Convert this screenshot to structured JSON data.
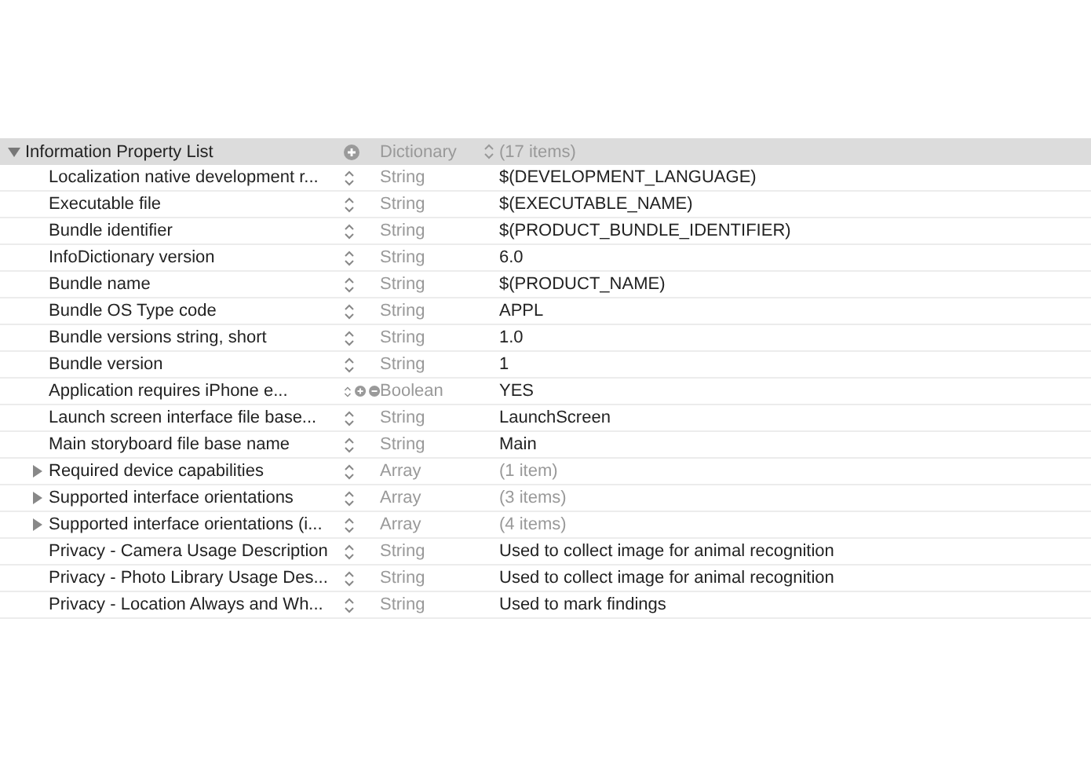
{
  "property_list": {
    "key": "Information Property List",
    "kind": "dictionary",
    "type": "Dictionary",
    "value": "(17 items)",
    "expanded": true,
    "children": [
      {
        "key": "Localization native development r...",
        "kind": "string",
        "type": "String",
        "value": "$(DEVELOPMENT_LANGUAGE)",
        "hovered": false
      },
      {
        "key": "Executable file",
        "kind": "string",
        "type": "String",
        "value": "$(EXECUTABLE_NAME)",
        "hovered": false
      },
      {
        "key": "Bundle identifier",
        "kind": "string",
        "type": "String",
        "value": "$(PRODUCT_BUNDLE_IDENTIFIER)",
        "hovered": false
      },
      {
        "key": "InfoDictionary version",
        "kind": "string",
        "type": "String",
        "value": "6.0",
        "hovered": false
      },
      {
        "key": "Bundle name",
        "kind": "string",
        "type": "String",
        "value": "$(PRODUCT_NAME)",
        "hovered": false
      },
      {
        "key": "Bundle OS Type code",
        "kind": "string",
        "type": "String",
        "value": "APPL",
        "hovered": false
      },
      {
        "key": "Bundle versions string, short",
        "kind": "string",
        "type": "String",
        "value": "1.0",
        "hovered": false
      },
      {
        "key": "Bundle version",
        "kind": "string",
        "type": "String",
        "value": "1",
        "hovered": false
      },
      {
        "key": "Application requires iPhone e...",
        "kind": "boolean",
        "type": "Boolean",
        "value": "YES",
        "hovered": true
      },
      {
        "key": "Launch screen interface file base...",
        "kind": "string",
        "type": "String",
        "value": "LaunchScreen",
        "hovered": false
      },
      {
        "key": "Main storyboard file base name",
        "kind": "string",
        "type": "String",
        "value": "Main",
        "hovered": false
      },
      {
        "key": "Required device capabilities",
        "kind": "array",
        "type": "Array",
        "value": "(1 item)",
        "expanded": false,
        "hovered": false
      },
      {
        "key": "Supported interface orientations",
        "kind": "array",
        "type": "Array",
        "value": "(3 items)",
        "expanded": false,
        "hovered": false
      },
      {
        "key": "Supported interface orientations (i...",
        "kind": "array",
        "type": "Array",
        "value": "(4 items)",
        "expanded": false,
        "hovered": false
      },
      {
        "key": "Privacy - Camera Usage Description",
        "kind": "string",
        "type": "String",
        "value": "Used to collect image for animal recognition",
        "hovered": false
      },
      {
        "key": "Privacy - Photo Library Usage Des...",
        "kind": "string",
        "type": "String",
        "value": "Used to collect image for animal recognition",
        "hovered": false
      },
      {
        "key": "Privacy - Location Always and Wh...",
        "kind": "string",
        "type": "String",
        "value": "Used to mark findings",
        "hovered": false
      }
    ]
  }
}
